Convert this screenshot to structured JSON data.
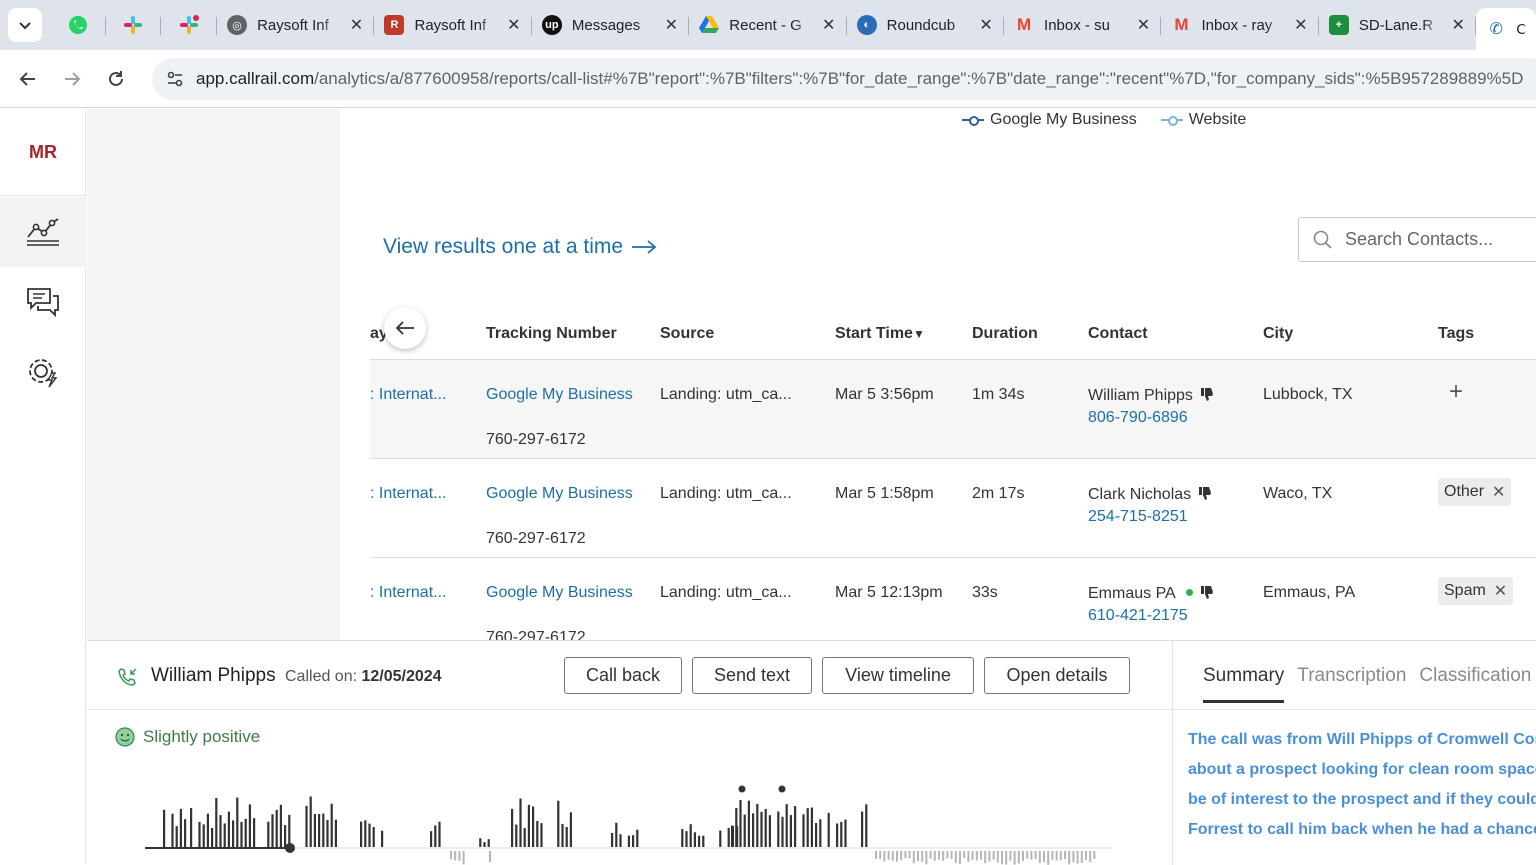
{
  "browser": {
    "tabs": [
      {
        "title": "Raysoft Inf",
        "icon": "globe-icon",
        "color": "#5f6368"
      },
      {
        "title": "Raysoft Inf",
        "icon": "raysoft-logo-icon",
        "color": "#c0392b"
      },
      {
        "title": "Messages",
        "icon": "upwork-icon",
        "color": "#111111"
      },
      {
        "title": "Recent - G",
        "icon": "google-drive-icon",
        "color": "#1a73e8"
      },
      {
        "title": "Roundcub",
        "icon": "roundcube-icon",
        "color": "#2d6cb5"
      },
      {
        "title": "Inbox - su",
        "icon": "gmail-icon",
        "color": "#ea4335"
      },
      {
        "title": "Inbox - ray",
        "icon": "gmail-icon",
        "color": "#ea4335"
      },
      {
        "title": "SD-Lane.R",
        "icon": "google-sheets-icon",
        "color": "#1e8e3e"
      },
      {
        "title": "C",
        "icon": "callrail-icon",
        "color": "#1d6fa8"
      }
    ],
    "url_host": "app.callrail.com",
    "url_path": "/analytics/a/877600958/reports/call-list#%7B\"report\":%7B\"filters\":%7B\"for_date_range\":%7B\"date_range\":\"recent\"%7D,\"for_company_sids\":%5B957289889%5D"
  },
  "rail": {
    "avatar": "MR"
  },
  "legend": [
    "Google My Business",
    "Website"
  ],
  "view_link": "View results one at a time",
  "search": {
    "placeholder": "Search Contacts..."
  },
  "table": {
    "headers": {
      "company": "ay",
      "tracking": "Tracking Number",
      "source": "Source",
      "start": "Start Time",
      "duration": "Duration",
      "contact": "Contact",
      "city": "City",
      "tags": "Tags"
    },
    "rows": [
      {
        "company": ": Internat...",
        "tracking_name": "Google My Business",
        "tracking_number": "760-297-6172",
        "source": "Landing: utm_ca...",
        "start": "Mar 5 3:56pm",
        "duration": "1m 34s",
        "contact_name": "William Phipps",
        "contact_phone": "806-790-6896",
        "city": "Lubbock, TX",
        "tag": ""
      },
      {
        "company": ": Internat...",
        "tracking_name": "Google My Business",
        "tracking_number": "760-297-6172",
        "source": "Landing: utm_ca...",
        "start": "Mar 5 1:58pm",
        "duration": "2m 17s",
        "contact_name": "Clark Nicholas",
        "contact_phone": "254-715-8251",
        "city": "Waco, TX",
        "tag": "Other"
      },
      {
        "company": ": Internat...",
        "tracking_name": "Google My Business",
        "tracking_number": "760-297-6172",
        "source": "Landing: utm_ca...",
        "start": "Mar 5 12:13pm",
        "duration": "33s",
        "contact_name": "Emmaus PA",
        "contact_phone": "610-421-2175",
        "city": "Emmaus, PA",
        "tag": "Spam"
      }
    ]
  },
  "call_panel": {
    "caller": "William Phipps",
    "called_on_label": "Called on:",
    "called_on_date": "12/05/2024",
    "buttons": {
      "call_back": "Call back",
      "send_text": "Send text",
      "view_timeline": "View timeline",
      "open_details": "Open details"
    },
    "sentiment": "Slightly positive",
    "tabs": {
      "summary": "Summary",
      "transcription": "Transcription",
      "classification": "Classification"
    },
    "summary_lines": [
      "The call was from Will Phipps of Cromwell Com",
      "about a prospect looking for clean room space.",
      "be of interest to the prospect and if they could",
      "Forrest to call him back when he had a chance."
    ]
  },
  "colors": {
    "accent_link": "#1d6fa8",
    "summary_text": "#4a90d9",
    "sentiment_green": "#3c7d4a",
    "avatar_red": "#a3242a"
  }
}
